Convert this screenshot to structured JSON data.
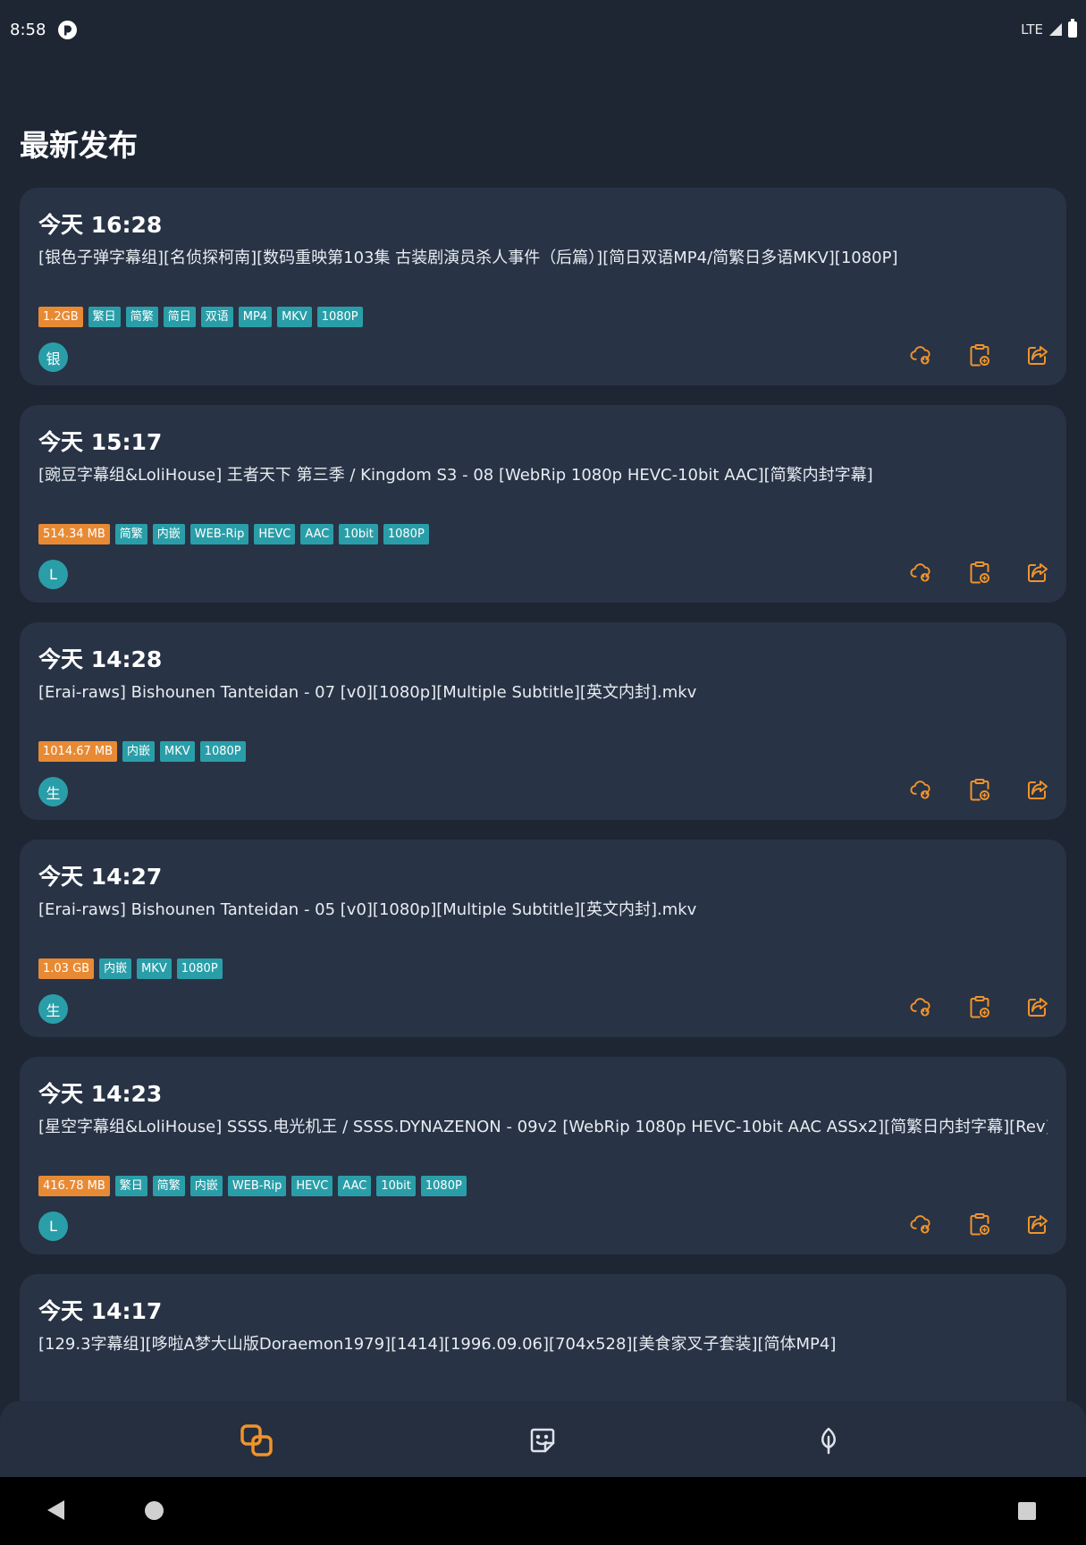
{
  "status_bar": {
    "time": "8:58",
    "network": "LTE"
  },
  "page_title": "最新发布",
  "colors": {
    "accent": "#f0932b",
    "tag": "#2a9ea8",
    "size_tag": "#e88a34",
    "card": "#283345",
    "background": "#1e2633"
  },
  "releases": [
    {
      "time": "今天 16:28",
      "title": "[银色子弹字幕组][名侦探柯南][数码重映第103集 古装剧演员杀人事件（后篇）][简日双语MP4/简繁日多语MKV][1080P]",
      "size": "1.2GB",
      "tags": [
        "繁日",
        "简繁",
        "简日",
        "双语",
        "MP4",
        "MKV",
        "1080P"
      ],
      "avatar": "银"
    },
    {
      "time": "今天 15:17",
      "title": "[豌豆字幕组&LoliHouse] 王者天下 第三季 / Kingdom S3 - 08 [WebRip 1080p HEVC-10bit AAC][简繁内封字幕]",
      "size": "514.34 MB",
      "tags": [
        "简繁",
        "内嵌",
        "WEB-Rip",
        "HEVC",
        "AAC",
        "10bit",
        "1080P"
      ],
      "avatar": "L"
    },
    {
      "time": "今天 14:28",
      "title": "[Erai-raws] Bishounen Tanteidan - 07 [v0][1080p][Multiple Subtitle][英文内封].mkv",
      "size": "1014.67 MB",
      "tags": [
        "内嵌",
        "MKV",
        "1080P"
      ],
      "avatar": "生"
    },
    {
      "time": "今天 14:27",
      "title": "[Erai-raws] Bishounen Tanteidan - 05 [v0][1080p][Multiple Subtitle][英文内封].mkv",
      "size": "1.03 GB",
      "tags": [
        "内嵌",
        "MKV",
        "1080P"
      ],
      "avatar": "生"
    },
    {
      "time": "今天 14:23",
      "title": "[星空字幕组&LoliHouse] SSSS.电光机王 / SSSS.DYNAZENON - 09v2 [WebRip 1080p HEVC-10bit AAC ASSx2][简繁日内封字幕][Rev]",
      "size": "416.78 MB",
      "tags": [
        "繁日",
        "简繁",
        "内嵌",
        "WEB-Rip",
        "HEVC",
        "AAC",
        "10bit",
        "1080P"
      ],
      "avatar": "L"
    },
    {
      "time": "今天 14:17",
      "title": "[129.3字幕组][哆啦A梦大山版Doraemon1979][1414][1996.09.06][704x528][美食家叉子套装][简体MP4]",
      "size": "",
      "tags": [],
      "avatar": ""
    }
  ],
  "card_actions": [
    "cloud-download-icon",
    "clipboard-copy-icon",
    "share-icon"
  ],
  "bottom_nav": [
    "releases-icon",
    "sticker-icon",
    "leaf-icon"
  ]
}
